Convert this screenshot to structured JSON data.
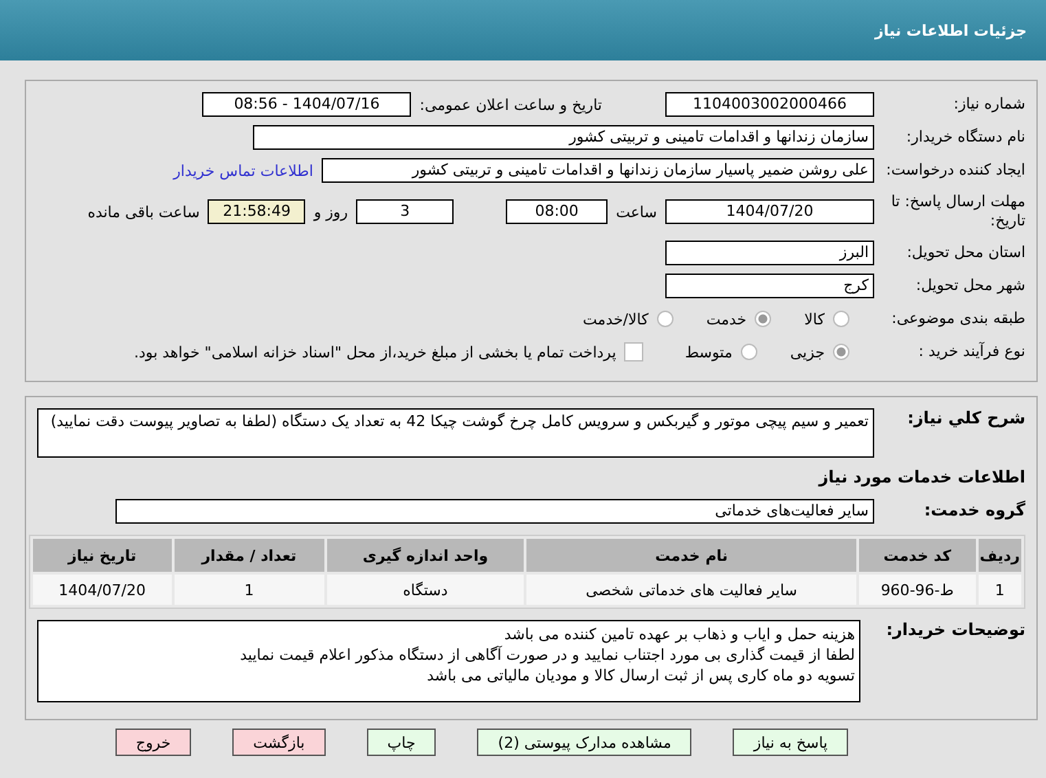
{
  "window": {
    "title": "جزئیات اطلاعات نیاز"
  },
  "need_number": {
    "label": "شماره نیاز:",
    "value": "1104003002000466"
  },
  "announce": {
    "label": "تاریخ و ساعت اعلان عمومی:",
    "value": "1404/07/16 - 08:56"
  },
  "buyer": {
    "label": "نام دستگاه خریدار:",
    "value": "سازمان زندانها و اقدامات تامینی و تربیتی کشور"
  },
  "creator": {
    "label": "ایجاد کننده درخواست:",
    "value": "علی روشن ضمیر پاسیار سازمان زندانها و اقدامات تامینی و تربیتی کشور",
    "link": "اطلاعات تماس خریدار"
  },
  "deadline": {
    "label": "مهلت ارسال پاسخ: تا تاریخ:",
    "date": "1404/07/20",
    "time_label": "ساعت",
    "time": "08:00",
    "days": "3",
    "days_label": "روز و",
    "remaining": "21:58:49",
    "remaining_label": "ساعت باقی مانده"
  },
  "province": {
    "label": "استان محل تحویل:",
    "value": "البرز"
  },
  "city": {
    "label": "شهر محل تحویل:",
    "value": "کرج"
  },
  "category": {
    "label": "طبقه بندی موضوعی:",
    "options": [
      {
        "label": "کالا",
        "selected": false
      },
      {
        "label": "خدمت",
        "selected": true
      },
      {
        "label": "کالا/خدمت",
        "selected": false
      }
    ]
  },
  "process": {
    "label": "نوع فرآیند خرید :",
    "options": [
      {
        "label": "جزیی",
        "selected": true
      },
      {
        "label": "متوسط",
        "selected": false
      }
    ],
    "treasury": {
      "checked": false,
      "label": "پرداخت تمام یا بخشی از مبلغ خرید،از محل \"اسناد خزانه اسلامی\" خواهد بود."
    }
  },
  "description": {
    "label": "شرح کلي نياز:",
    "value": "تعمیر و سیم پیچی موتور و گیربکس  و سرویس کامل چرخ گوشت چیکا 42 به تعداد یک دستگاه (لطفا به تصاویر پیوست دقت نمایید)"
  },
  "services_heading": "اطلاعات خدمات مورد نیاز",
  "service_group": {
    "label": "گروه خدمت:",
    "value": "سایر فعالیت‌های خدماتی"
  },
  "table": {
    "columns": [
      "ردیف",
      "کد خدمت",
      "نام خدمت",
      "واحد اندازه گیری",
      "تعداد / مقدار",
      "تاریخ نیاز"
    ],
    "rows": [
      [
        "1",
        "ط-96-960",
        "سایر فعالیت های خدماتی شخصی",
        "دستگاه",
        "1",
        "1404/07/20"
      ]
    ]
  },
  "buyer_notes": {
    "label": "توضیحات خریدار:",
    "lines": [
      "هزینه حمل و ایاب و ذهاب بر عهده تامین کننده می باشد",
      "لطفا از قیمت گذاری بی مورد اجتناب نمایید و در صورت آگاهی از دستگاه مذکور اعلام قیمت نمایید",
      "تسویه دو ماه کاری پس از ثبت ارسال کالا و مودیان مالیاتی می باشد"
    ]
  },
  "buttons": [
    {
      "label": "پاسخ به نیاز",
      "kind": "action"
    },
    {
      "label": "مشاهده مدارک پیوستی (2)",
      "kind": "action"
    },
    {
      "label": "چاپ",
      "kind": "action"
    },
    {
      "label": "بازگشت",
      "kind": "exit"
    },
    {
      "label": "خروج",
      "kind": "exit"
    }
  ]
}
